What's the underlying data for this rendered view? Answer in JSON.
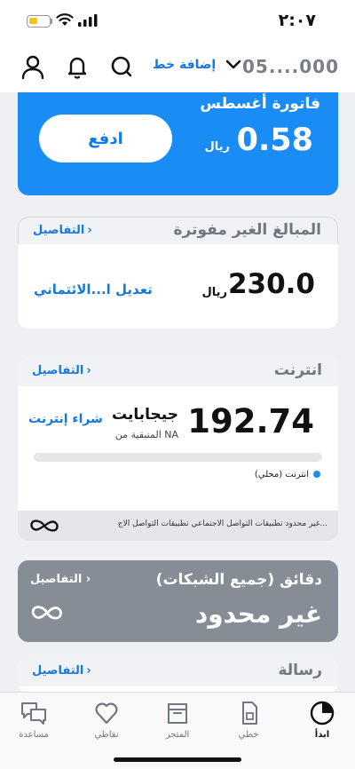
{
  "status": {
    "time": "٢:٠٧"
  },
  "header": {
    "account_number": "05....000",
    "add_line": "إضافة خط"
  },
  "bill": {
    "title": "فاتورة أغسطس",
    "amount": "0.58",
    "currency": "ريال",
    "pay_button": "ادفع"
  },
  "unbilled": {
    "title": "المبالغ الغير مفوترة",
    "details": "التفاصيل",
    "amount": "230.0",
    "currency": "ريال",
    "credit_link": "تعديل ا...الائتماني"
  },
  "internet": {
    "title": "انترنت",
    "details": "التفاصيل",
    "amount": "192.74",
    "unit": "جيجابايت",
    "remaining": "المتبقية من NA",
    "buy_link": "شراء إنترنت",
    "legend": "انترنت (محلي)",
    "progress_fraction": 0,
    "social_text": "غير محدود تطبيقات التواصل الاجتماعي تطبيقات التواصل الاج..."
  },
  "minutes": {
    "title": "دقائق (جميع الشبكات)",
    "details": "التفاصيل",
    "value": "غير محدود"
  },
  "message": {
    "title": "رسالة",
    "details": "التفاصيل"
  },
  "tabs": [
    {
      "label": "ابدأ",
      "icon": "home-pie-icon",
      "active": true
    },
    {
      "label": "خطي",
      "icon": "sim-card-icon",
      "active": false
    },
    {
      "label": "المتجر",
      "icon": "store-box-icon",
      "active": false
    },
    {
      "label": "نقاطي",
      "icon": "heart-icon",
      "active": false
    },
    {
      "label": "مساعدة",
      "icon": "chat-bubbles-icon",
      "active": false
    }
  ],
  "colors": {
    "accent": "#1a8cf5",
    "link": "#1479e0",
    "minutes_card": "#878d97",
    "background": "#eef0f4"
  }
}
